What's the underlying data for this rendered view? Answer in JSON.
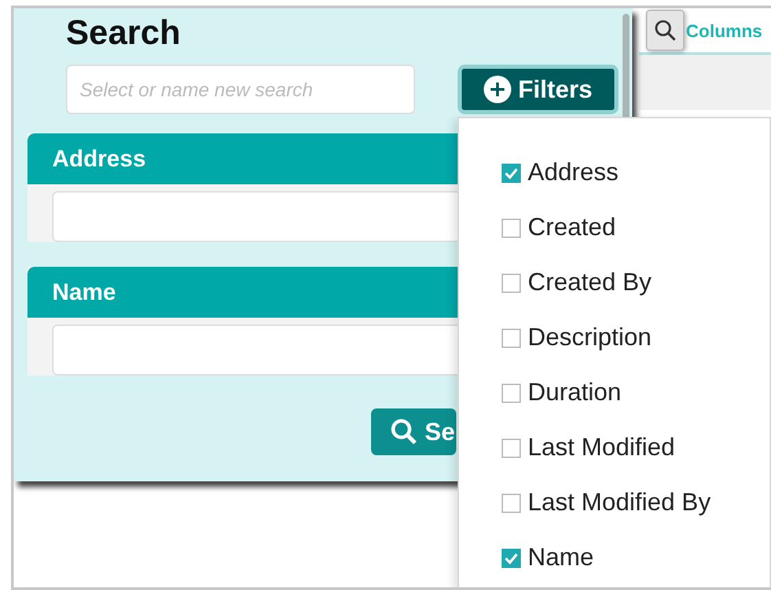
{
  "page": {
    "columns_link": "Columns"
  },
  "search_panel": {
    "title": "Search",
    "search_name": {
      "placeholder": "Select or name new search"
    },
    "filters_button": "Filters",
    "fields": [
      {
        "label": "Address"
      },
      {
        "label": "Name"
      }
    ],
    "search_button": "Se"
  },
  "filters_menu": [
    {
      "label": "Address",
      "checked": true
    },
    {
      "label": "Created",
      "checked": false
    },
    {
      "label": "Created By",
      "checked": false
    },
    {
      "label": "Description",
      "checked": false
    },
    {
      "label": "Duration",
      "checked": false
    },
    {
      "label": "Last Modified",
      "checked": false
    },
    {
      "label": "Last Modified By",
      "checked": false
    },
    {
      "label": "Name",
      "checked": true
    }
  ]
}
